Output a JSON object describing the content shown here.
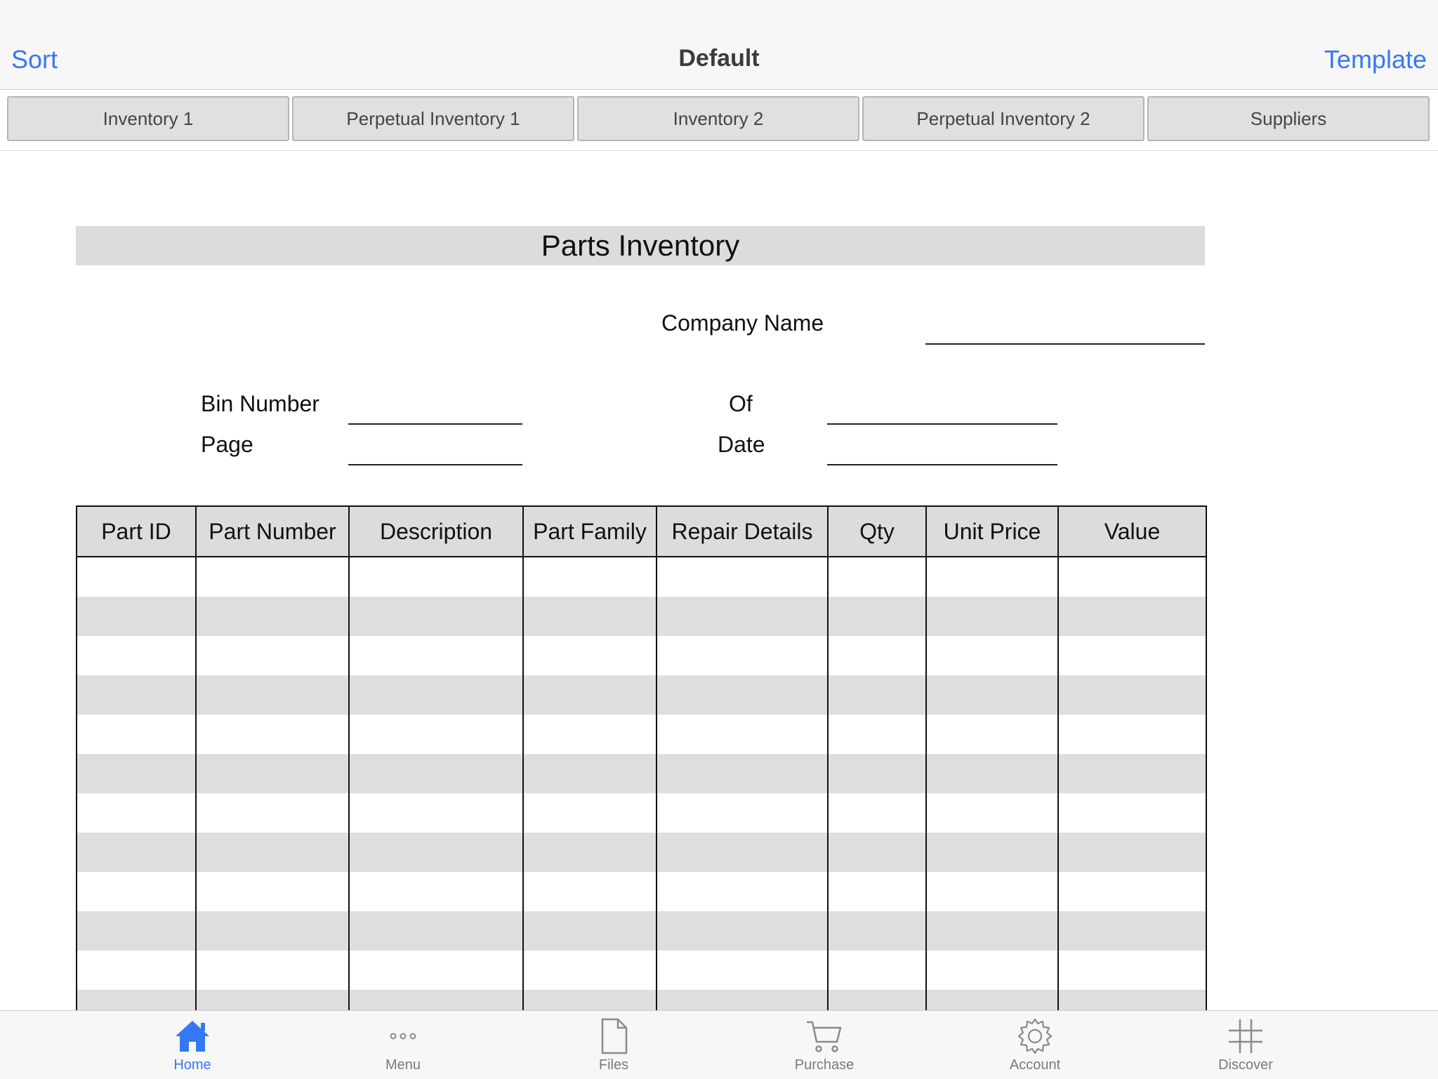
{
  "navbar": {
    "left_button": "Sort",
    "title": "Default",
    "right_button": "Template",
    "accent_color": "#3478f6"
  },
  "tabs": [
    {
      "label": "Inventory 1"
    },
    {
      "label": "Perpetual Inventory 1"
    },
    {
      "label": "Inventory 2"
    },
    {
      "label": "Perpetual Inventory 2"
    },
    {
      "label": "Suppliers"
    }
  ],
  "document": {
    "title": "Parts Inventory",
    "fields": {
      "company_name": "Company Name",
      "bin_number": "Bin Number",
      "of": "Of",
      "page": "Page",
      "date": "Date"
    },
    "table": {
      "headers": [
        "Part ID",
        "Part Number",
        "Description",
        "Part Family",
        "Repair Details",
        "Qty",
        "Unit Price",
        "Value"
      ]
    }
  },
  "tabbar": {
    "items": [
      {
        "label": "Home",
        "icon": "home-icon",
        "active": true
      },
      {
        "label": "Menu",
        "icon": "more-icon"
      },
      {
        "label": "Files",
        "icon": "file-icon"
      },
      {
        "label": "Purchase",
        "icon": "cart-icon"
      },
      {
        "label": "Account",
        "icon": "gear-icon"
      },
      {
        "label": "Discover",
        "icon": "grid-icon"
      }
    ]
  }
}
